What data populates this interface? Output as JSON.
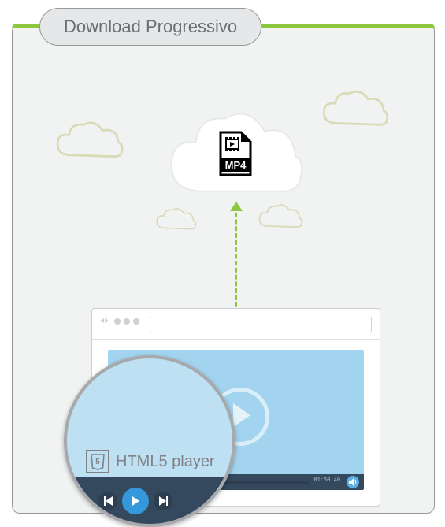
{
  "header": {
    "title": "Download Progressivo"
  },
  "file": {
    "format_label": "MP4"
  },
  "player": {
    "label": "HTML5 player",
    "time": "01:50:40"
  },
  "icons": {
    "file": "mp4-file-icon",
    "html5": "html5-badge-icon",
    "volume": "volume-icon",
    "play": "play-icon",
    "prev": "previous-icon",
    "next": "next-icon"
  }
}
